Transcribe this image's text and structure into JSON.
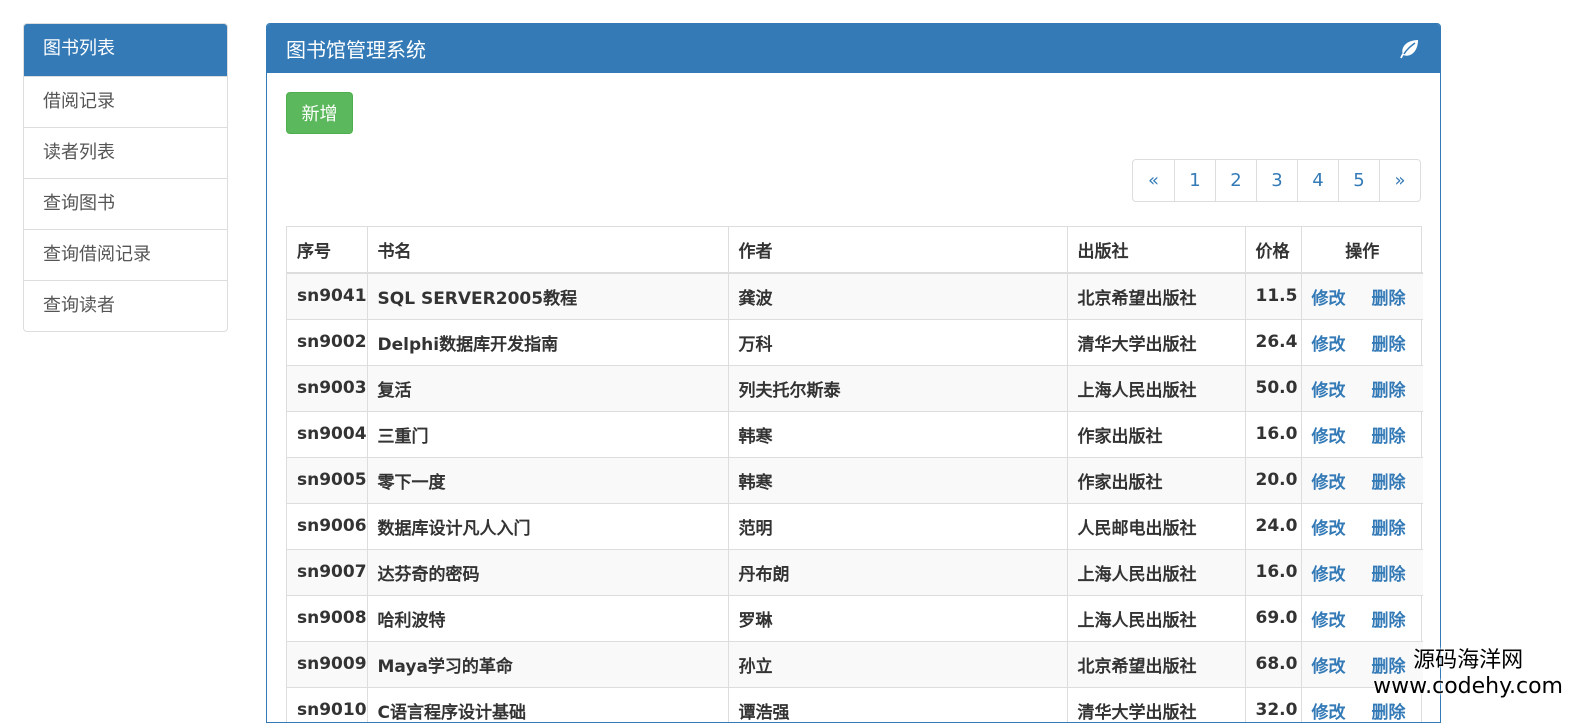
{
  "sidebar": {
    "items": [
      {
        "label": "图书列表"
      },
      {
        "label": "借阅记录"
      },
      {
        "label": "读者列表"
      },
      {
        "label": "查询图书"
      },
      {
        "label": "查询借阅记录"
      },
      {
        "label": "查询读者"
      }
    ],
    "active_index": 0
  },
  "panel": {
    "title": "图书馆管理系统",
    "icon": "leaf-icon",
    "add_label": "新增"
  },
  "pagination": {
    "prev": "«",
    "pages": [
      "1",
      "2",
      "3",
      "4",
      "5"
    ],
    "next": "»"
  },
  "table": {
    "headers": [
      "序号",
      "书名",
      "作者",
      "出版社",
      "价格",
      "操作"
    ],
    "edit_label": "修改",
    "delete_label": "删除",
    "rows": [
      {
        "id": "sn9041",
        "title": "SQL SERVER2005教程",
        "author": "龚波",
        "publisher": "北京希望出版社",
        "price": "11.5"
      },
      {
        "id": "sn9002",
        "title": "Delphi数据库开发指南",
        "author": "万科",
        "publisher": "清华大学出版社",
        "price": "26.4"
      },
      {
        "id": "sn9003",
        "title": "复活",
        "author": "列夫托尔斯泰",
        "publisher": "上海人民出版社",
        "price": "50.0"
      },
      {
        "id": "sn9004",
        "title": "三重门",
        "author": "韩寒",
        "publisher": "作家出版社",
        "price": "16.0"
      },
      {
        "id": "sn9005",
        "title": "零下一度",
        "author": "韩寒",
        "publisher": "作家出版社",
        "price": "20.0"
      },
      {
        "id": "sn9006",
        "title": "数据库设计凡人入门",
        "author": "范明",
        "publisher": "人民邮电出版社",
        "price": "24.0"
      },
      {
        "id": "sn9007",
        "title": "达芬奇的密码",
        "author": "丹布朗",
        "publisher": "上海人民出版社",
        "price": "16.0"
      },
      {
        "id": "sn9008",
        "title": "哈利波特",
        "author": "罗琳",
        "publisher": "上海人民出版社",
        "price": "69.0"
      },
      {
        "id": "sn9009",
        "title": "Maya学习的革命",
        "author": "孙立",
        "publisher": "北京希望出版社",
        "price": "68.0"
      },
      {
        "id": "sn9010",
        "title": "C语言程序设计基础",
        "author": "谭浩强",
        "publisher": "清华大学出版社",
        "price": "32.0"
      }
    ]
  },
  "watermark": {
    "line1": "源码海洋网",
    "line2": "www.codehy.com"
  },
  "colors": {
    "primary": "#337ab7",
    "success": "#5cb85c"
  }
}
